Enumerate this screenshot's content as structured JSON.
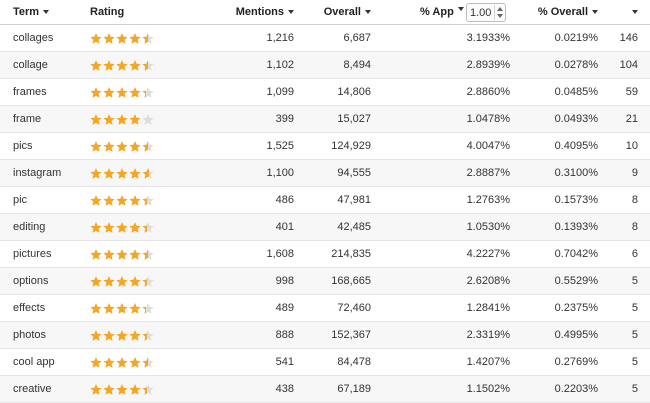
{
  "colors": {
    "star": "#f5a623",
    "star_empty": "#dddddd",
    "row_alt": "#f7f7f7"
  },
  "header": {
    "term": "Term",
    "rating": "Rating",
    "mentions": "Mentions",
    "overall": "Overall",
    "pct_app": "% App",
    "app_multiplier": "1.00",
    "pct_overall": "% Overall",
    "sort_icon": "caret-down-icon"
  },
  "rows": [
    {
      "term": "collages",
      "rating": 4.5,
      "mentions": "1,216",
      "overall": "6,687",
      "pct_app": "3.1933%",
      "pct_overall": "0.0219%",
      "rank": "146"
    },
    {
      "term": "collage",
      "rating": 4.5,
      "mentions": "1,102",
      "overall": "8,494",
      "pct_app": "2.8939%",
      "pct_overall": "0.0278%",
      "rank": "104"
    },
    {
      "term": "frames",
      "rating": 4.3,
      "mentions": "1,099",
      "overall": "14,806",
      "pct_app": "2.8860%",
      "pct_overall": "0.0485%",
      "rank": "59"
    },
    {
      "term": "frame",
      "rating": 3.9,
      "mentions": "399",
      "overall": "15,027",
      "pct_app": "1.0478%",
      "pct_overall": "0.0493%",
      "rank": "21"
    },
    {
      "term": "pics",
      "rating": 4.5,
      "mentions": "1,525",
      "overall": "124,929",
      "pct_app": "4.0047%",
      "pct_overall": "0.4095%",
      "rank": "10"
    },
    {
      "term": "instagram",
      "rating": 4.6,
      "mentions": "1,100",
      "overall": "94,555",
      "pct_app": "2.8887%",
      "pct_overall": "0.3100%",
      "rank": "9"
    },
    {
      "term": "pic",
      "rating": 4.4,
      "mentions": "486",
      "overall": "47,981",
      "pct_app": "1.2763%",
      "pct_overall": "0.1573%",
      "rank": "8"
    },
    {
      "term": "editing",
      "rating": 4.4,
      "mentions": "401",
      "overall": "42,485",
      "pct_app": "1.0530%",
      "pct_overall": "0.1393%",
      "rank": "8"
    },
    {
      "term": "pictures",
      "rating": 4.5,
      "mentions": "1,608",
      "overall": "214,835",
      "pct_app": "4.2227%",
      "pct_overall": "0.7042%",
      "rank": "6"
    },
    {
      "term": "options",
      "rating": 4.4,
      "mentions": "998",
      "overall": "168,665",
      "pct_app": "2.6208%",
      "pct_overall": "0.5529%",
      "rank": "5"
    },
    {
      "term": "effects",
      "rating": 4.3,
      "mentions": "489",
      "overall": "72,460",
      "pct_app": "1.2841%",
      "pct_overall": "0.2375%",
      "rank": "5"
    },
    {
      "term": "photos",
      "rating": 4.4,
      "mentions": "888",
      "overall": "152,367",
      "pct_app": "2.3319%",
      "pct_overall": "0.4995%",
      "rank": "5"
    },
    {
      "term": "cool app",
      "rating": 4.5,
      "mentions": "541",
      "overall": "84,478",
      "pct_app": "1.4207%",
      "pct_overall": "0.2769%",
      "rank": "5"
    },
    {
      "term": "creative",
      "rating": 4.4,
      "mentions": "438",
      "overall": "67,189",
      "pct_app": "1.1502%",
      "pct_overall": "0.2203%",
      "rank": "5"
    }
  ]
}
